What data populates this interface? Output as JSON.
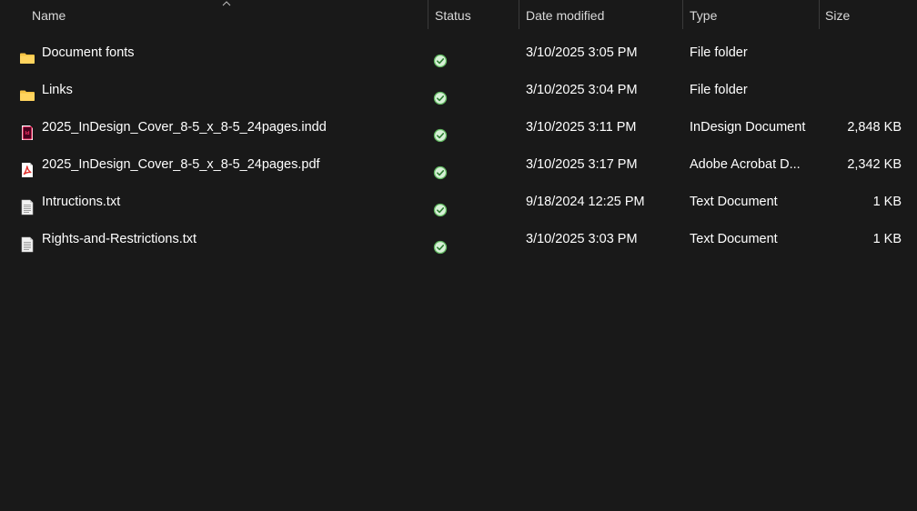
{
  "columns": {
    "name": "Name",
    "status": "Status",
    "date": "Date modified",
    "type": "Type",
    "size": "Size"
  },
  "sort": {
    "column": "name",
    "direction": "ascending"
  },
  "files": [
    {
      "icon": "folder-icon",
      "name": "Document fonts",
      "status": "available-on-device",
      "date": "3/10/2025 3:05 PM",
      "type": "File folder",
      "size": ""
    },
    {
      "icon": "folder-icon",
      "name": "Links",
      "status": "available-on-device",
      "date": "3/10/2025 3:04 PM",
      "type": "File folder",
      "size": ""
    },
    {
      "icon": "indesign-file-icon",
      "name": "2025_InDesign_Cover_8-5_x_8-5_24pages.indd",
      "status": "available-on-device",
      "date": "3/10/2025 3:11 PM",
      "type": "InDesign Document",
      "size": "2,848 KB"
    },
    {
      "icon": "pdf-file-icon",
      "name": "2025_InDesign_Cover_8-5_x_8-5_24pages.pdf",
      "status": "available-on-device",
      "date": "3/10/2025 3:17 PM",
      "type": "Adobe Acrobat D...",
      "size": "2,342 KB"
    },
    {
      "icon": "text-file-icon",
      "name": "Intructions.txt",
      "status": "available-on-device",
      "date": "9/18/2024 12:25 PM",
      "type": "Text Document",
      "size": "1 KB"
    },
    {
      "icon": "text-file-icon",
      "name": "Rights-and-Restrictions.txt",
      "status": "available-on-device",
      "date": "3/10/2025 3:03 PM",
      "type": "Text Document",
      "size": "1 KB"
    }
  ],
  "colors": {
    "background": "#191919",
    "header_text": "#d9d9d9",
    "folder": "#f6c343",
    "indesign": "#ff3366",
    "pdf": "#e0302d",
    "status_green": "#5fb85f"
  }
}
